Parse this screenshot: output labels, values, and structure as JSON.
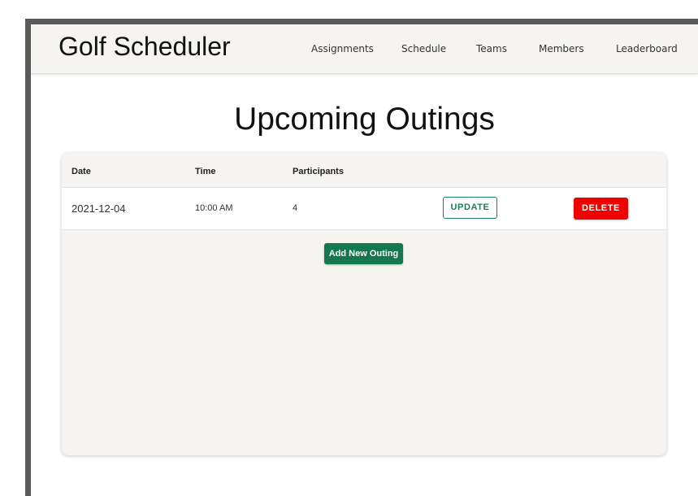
{
  "app": {
    "brand": "Golf Scheduler"
  },
  "nav": {
    "items": [
      {
        "label": "Assignments"
      },
      {
        "label": "Schedule"
      },
      {
        "label": "Teams"
      },
      {
        "label": "Members"
      },
      {
        "label": "Leaderboard"
      }
    ]
  },
  "main": {
    "title": "Upcoming Outings",
    "table": {
      "columns": [
        "Date",
        "Time",
        "Participants"
      ],
      "rows": [
        {
          "date": "2021-12-04",
          "time": "10:00 AM",
          "participants": "4",
          "update_label": "UPDATE",
          "delete_label": "DELETE"
        }
      ]
    },
    "add_button_label": "Add New Outing"
  },
  "colors": {
    "nav_background": "#f5f4f0",
    "card_background": "#f5f4f0",
    "primary_green": "#14784f",
    "update_outline": "#1b7f5a",
    "delete_red": "#f20000",
    "frame_gray": "#5a5a5a"
  }
}
